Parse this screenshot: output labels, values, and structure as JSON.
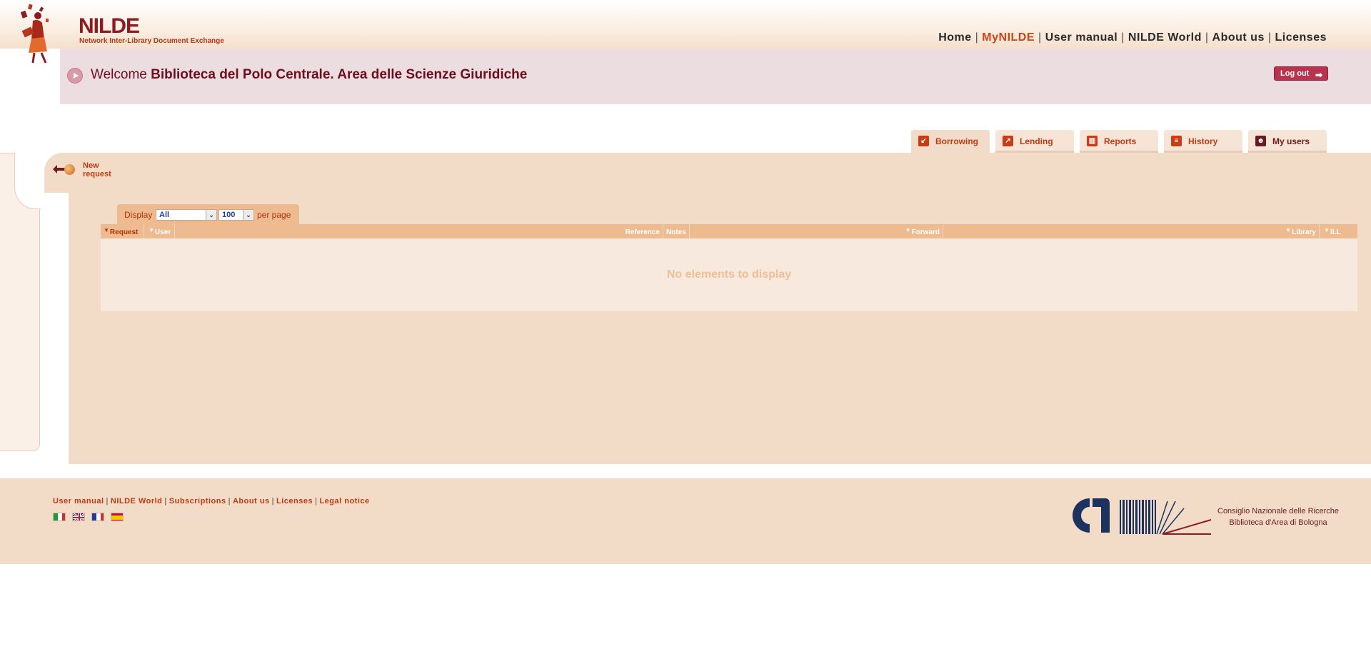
{
  "brand": {
    "title": "NILDE",
    "subtitle": "Network Inter-Library Document Exchange"
  },
  "topnav": {
    "items": [
      "Home",
      "MyNILDE",
      "User manual",
      "NILDE World",
      "About us",
      "Licenses"
    ],
    "active": "MyNILDE",
    "separator": "|"
  },
  "welcome": {
    "prefix": "Welcome",
    "name": "Biblioteca del Polo Centrale. Area delle Scienze Giuridiche",
    "logout_label": "Log out"
  },
  "tabs": [
    {
      "label": "Borrowing",
      "icon": "borrowing-arrow-icon",
      "active": true
    },
    {
      "label": "Lending",
      "icon": "lending-arrow-icon",
      "active": false
    },
    {
      "label": "Reports",
      "icon": "bar-chart-icon",
      "active": false
    },
    {
      "label": "History",
      "icon": "list-icon",
      "active": false
    },
    {
      "label": "My users",
      "icon": "users-icon",
      "active": false
    }
  ],
  "new_request": {
    "label": "New request"
  },
  "filter": {
    "display_label": "Display",
    "status_value": "All",
    "per_page_value": "100",
    "per_page_label": "per page"
  },
  "table": {
    "columns": [
      "Request",
      "User",
      "Reference",
      "Notes",
      "Forward",
      "Library",
      "ILL"
    ],
    "empty_message": "No elements to display"
  },
  "footer": {
    "links": [
      "User manual",
      "NILDE World",
      "Subscriptions",
      "About us",
      "Licenses",
      "Legal notice"
    ],
    "languages": [
      "italian-flag-icon",
      "english-flag-icon",
      "french-flag-icon",
      "spanish-flag-icon"
    ],
    "cnr_line1": "Consiglio Nazionale delle Ricerche",
    "cnr_line2": "Biblioteca d'Area di Bologna"
  },
  "colors": {
    "accent": "#c03a12",
    "brand_dark": "#6d0f1f",
    "panel": "#f2dcc8",
    "welcome_bg": "#ebdde0",
    "table_header": "#edbb8f"
  }
}
